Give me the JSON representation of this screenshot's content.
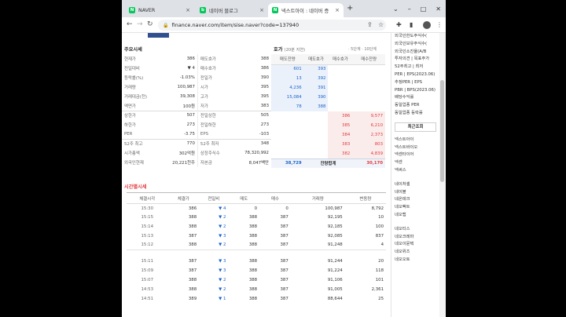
{
  "browser": {
    "tabs": [
      {
        "label": "NAVER",
        "icon": "naver-icon",
        "active": false
      },
      {
        "label": "네이버 블로그",
        "icon": "blog-icon",
        "active": false
      },
      {
        "label": "넥스트아이 : 네이버 증",
        "icon": "naver-finance-icon",
        "active": true
      }
    ],
    "url": "finance.naver.com/item/sise.naver?code=137940"
  },
  "stat_section": {
    "title": "주요시세",
    "rows": [
      [
        "현재가",
        "386",
        "매도호가",
        "388"
      ],
      [
        "전일대비",
        "▼ 4",
        "매수호가",
        "386"
      ],
      [
        "등락률(%)",
        "-1.03%",
        "전일가",
        "390"
      ],
      [
        "거래량",
        "100,987",
        "시가",
        "395"
      ],
      [
        "거래대금(천)",
        "39,308",
        "고가",
        "395"
      ],
      [
        "액면가",
        "100원",
        "저가",
        "383"
      ],
      [
        "상한가",
        "507",
        "전일상한",
        "505"
      ],
      [
        "하한가",
        "273",
        "전일하한",
        "273"
      ],
      [
        "PER",
        "-3.75",
        "EPS",
        "-103"
      ],
      [
        "52주 최고",
        "770",
        "52주 최저",
        "348"
      ],
      [
        "시가총액",
        "302억원",
        "상장주식수",
        "78,320,992"
      ],
      [
        "외국인현재",
        "20,221천주",
        "자본금",
        "8,047백만"
      ]
    ]
  },
  "hoga_section": {
    "title": "호가",
    "subtitle": "(20분 지연)",
    "options": "· 5단계 · 10단계",
    "headers": [
      "매도잔량",
      "매도호가",
      "매수호가",
      "매수잔량"
    ],
    "ask_rows": [
      [
        "601",
        "393"
      ],
      [
        "13",
        "392"
      ],
      [
        "4,236",
        "391"
      ],
      [
        "15,084",
        "390"
      ],
      [
        "78",
        "388"
      ]
    ],
    "bid_rows": [
      [
        "386",
        "9,577"
      ],
      [
        "385",
        "6,210"
      ],
      [
        "384",
        "2,373"
      ],
      [
        "383",
        "803"
      ],
      [
        "382",
        "4,839"
      ]
    ],
    "sum": [
      "38,729",
      "잔량합계",
      "30,170"
    ]
  },
  "tick_section": {
    "title": "시간별시세",
    "headers": [
      "체결시각",
      "체결가",
      "전일비",
      "매도",
      "매수",
      "거래량",
      "변동량"
    ],
    "rows": [
      [
        "15:30",
        "386",
        "▼ 4",
        "0",
        "0",
        "100,987",
        "8,792"
      ],
      [
        "15:15",
        "388",
        "▼ 2",
        "388",
        "387",
        "92,195",
        "10"
      ],
      [
        "15:14",
        "388",
        "▼ 2",
        "388",
        "387",
        "92,185",
        "100"
      ],
      [
        "15:13",
        "387",
        "▼ 3",
        "388",
        "387",
        "92,085",
        "837"
      ],
      [
        "15:12",
        "388",
        "▼ 2",
        "388",
        "387",
        "91,248",
        "4"
      ],
      [
        "15:11",
        "387",
        "▼ 3",
        "388",
        "387",
        "91,244",
        "20"
      ],
      [
        "15:09",
        "387",
        "▼ 3",
        "388",
        "387",
        "91,224",
        "118"
      ],
      [
        "15:07",
        "388",
        "▼ 2",
        "388",
        "387",
        "91,106",
        "101"
      ],
      [
        "14:53",
        "388",
        "▼ 2",
        "388",
        "387",
        "91,005",
        "2,361"
      ],
      [
        "14:51",
        "389",
        "▼ 1",
        "388",
        "387",
        "88,644",
        "25"
      ]
    ]
  },
  "sidebar": {
    "top_items": [
      "외국인한도주식수(",
      "외국인보유주식수(",
      "외국인소진율(A/B",
      "투자의견 | 목표주가",
      "52주최고 | 최저",
      "PER | EPS(2023.06)",
      "추정PER | EPS",
      "PBR | BPS(2023.06)",
      "배당수익률",
      "동일업종 PER",
      "동일업종 등락률"
    ],
    "button": "최근조회",
    "list_a": [
      "넥스트아이",
      "넥스트바이오",
      "넥센타이어",
      "넥센",
      "넥써스"
    ],
    "list_b": [
      "네이처셀",
      "네이블",
      "네온테크",
      "네오팩트",
      "네오랩"
    ],
    "list_c": [
      "네오티스",
      "네오크레마",
      "네오이뮨텍",
      "네오위즈",
      "네오오토"
    ]
  }
}
